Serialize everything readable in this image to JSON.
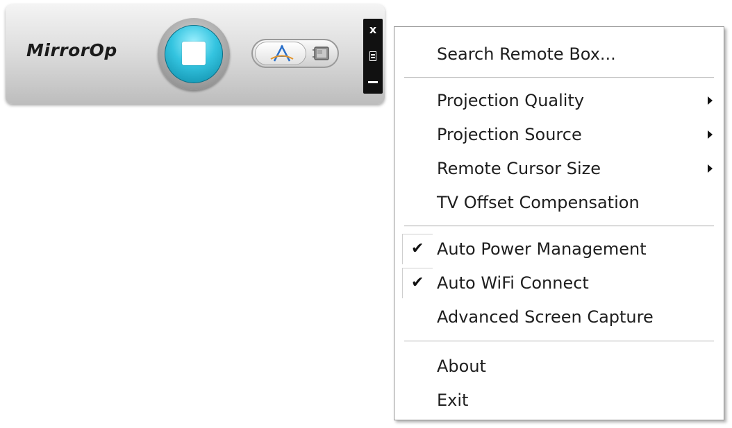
{
  "toolbar": {
    "logo_text": "MirrorOp",
    "close_glyph": "x",
    "icons": {
      "stop": "stop-square-icon",
      "projection": "projection-pyramid-icon",
      "media": "media-film-icon",
      "menu": "hamburger-menu-icon",
      "minimize": "minimize-icon",
      "close": "close-icon"
    },
    "accent_color": "#34c4e0"
  },
  "menu": {
    "search_remote_box": "Search Remote Box...",
    "projection_quality": "Projection Quality",
    "projection_source": "Projection Source",
    "remote_cursor_size": "Remote Cursor Size",
    "tv_offset_compensation": "TV Offset Compensation",
    "auto_power_management": "Auto Power Management",
    "auto_power_management_checked": true,
    "auto_wifi_connect": "Auto WiFi Connect",
    "auto_wifi_connect_checked": true,
    "advanced_screen_capture": "Advanced Screen Capture",
    "about": "About",
    "exit": "Exit",
    "check_glyph": "✔"
  }
}
